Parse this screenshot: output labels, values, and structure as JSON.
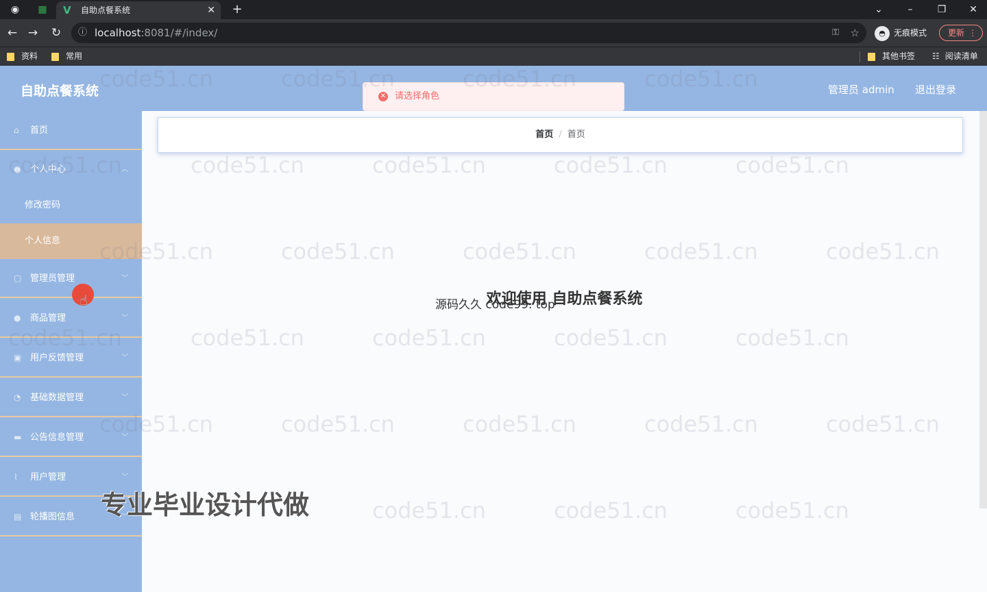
{
  "browser": {
    "tab_title": "自助点餐系统",
    "url_host": "localhost",
    "url_rest": ":8081/#/index/",
    "incognito_label": "无痕模式",
    "update_label": "更新",
    "bookmarks": [
      "资料",
      "常用"
    ],
    "other_bookmarks": "其他书签",
    "reading_list": "阅读清单"
  },
  "header": {
    "title": "自助点餐系统",
    "user_info": "管理员 admin",
    "logout": "退出登录"
  },
  "toast": {
    "message": "请选择角色"
  },
  "sidebar": {
    "home": "首页",
    "personal_center": "个人中心",
    "change_password": "修改密码",
    "personal_info": "个人信息",
    "admin_mgmt": "管理员管理",
    "goods_mgmt": "商品管理",
    "feedback_mgmt": "用户反馈管理",
    "base_data_mgmt": "基础数据管理",
    "notice_mgmt": "公告信息管理",
    "user_mgmt": "用户管理",
    "carousel_info": "轮播图信息"
  },
  "breadcrumb": {
    "first": "首页",
    "separator": "/",
    "second": "首页"
  },
  "main": {
    "welcome": "欢迎使用 自助点餐系统",
    "overlay": "源码久久 code99. top"
  },
  "promo": "专业毕业设计代做",
  "watermark": "code51.cn"
}
